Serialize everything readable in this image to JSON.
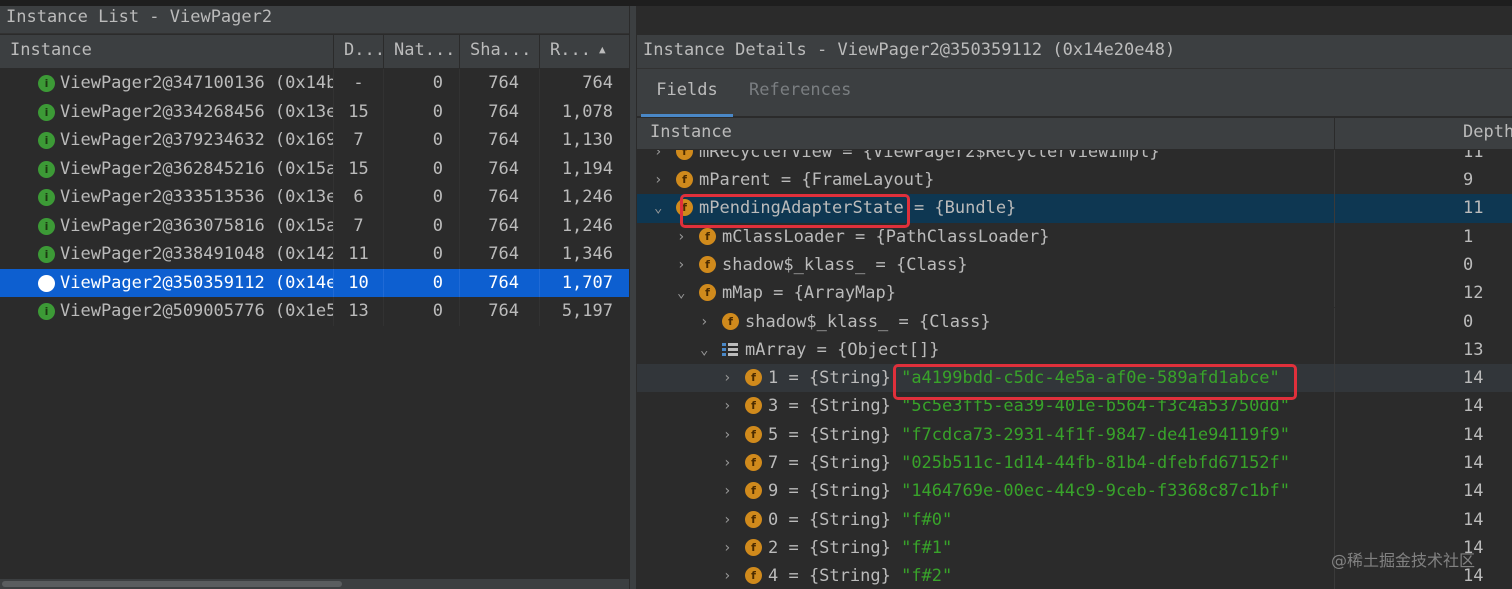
{
  "left_panel": {
    "title": "Instance List - ViewPager2",
    "columns": [
      "Instance",
      "D...",
      "Nat...",
      "Sha...",
      "R..."
    ],
    "rows": [
      {
        "name": "ViewPager2@347100136 (0x14b",
        "d": "-",
        "nat": "0",
        "sha": "764",
        "r": "764"
      },
      {
        "name": "ViewPager2@334268456 (0x13e",
        "d": "15",
        "nat": "0",
        "sha": "764",
        "r": "1,078"
      },
      {
        "name": "ViewPager2@379234632 (0x169",
        "d": "7",
        "nat": "0",
        "sha": "764",
        "r": "1,130"
      },
      {
        "name": "ViewPager2@362845216 (0x15a",
        "d": "15",
        "nat": "0",
        "sha": "764",
        "r": "1,194"
      },
      {
        "name": "ViewPager2@333513536 (0x13e",
        "d": "6",
        "nat": "0",
        "sha": "764",
        "r": "1,246"
      },
      {
        "name": "ViewPager2@363075816 (0x15a",
        "d": "7",
        "nat": "0",
        "sha": "764",
        "r": "1,246"
      },
      {
        "name": "ViewPager2@338491048 (0x142",
        "d": "11",
        "nat": "0",
        "sha": "764",
        "r": "1,346"
      },
      {
        "name": "ViewPager2@350359112 (0x14e",
        "d": "10",
        "nat": "0",
        "sha": "764",
        "r": "1,707"
      },
      {
        "name": "ViewPager2@509005776 (0x1e5",
        "d": "13",
        "nat": "0",
        "sha": "764",
        "r": "5,197"
      }
    ],
    "selected_index": 7,
    "instance_icon": "i"
  },
  "right_panel": {
    "title": "Instance Details - ViewPager2@350359112 (0x14e20e48)",
    "tabs": {
      "fields": "Fields",
      "references": "References"
    },
    "columns": {
      "instance": "Instance",
      "depth": "Depth"
    },
    "field_icon": "f",
    "rows": [
      {
        "text": "mRecyclerView = {ViewPager2$RecyclerViewImpl}",
        "depth": "11"
      },
      {
        "text": "mParent = {FrameLayout}",
        "depth": "9"
      },
      {
        "name": "mPendingAdapterState",
        "rest": " = {Bundle}",
        "depth": "11"
      },
      {
        "text": "mClassLoader = {PathClassLoader}",
        "depth": "1"
      },
      {
        "text": "shadow$_klass_ = {Class}",
        "depth": "0"
      },
      {
        "text": "mMap = {ArrayMap}",
        "depth": "12"
      },
      {
        "text": "shadow$_klass_ = {Class}",
        "depth": "0"
      },
      {
        "text": "mArray = {Object[]}",
        "depth": "13"
      },
      {
        "text": "1 = {String}",
        "value": "\"a4199bdd-c5dc-4e5a-af0e-589afd1abce\"",
        "depth": "14"
      },
      {
        "text": "3 = {String}",
        "value": "\"5c5e3ff5-ea39-401e-b564-f3c4a53750dd\"",
        "depth": "14"
      },
      {
        "text": "5 = {String}",
        "value": "\"f7cdca73-2931-4f1f-9847-de41e94119f9\"",
        "depth": "14"
      },
      {
        "text": "7 = {String}",
        "value": "\"025b511c-1d14-44fb-81b4-dfebfd67152f\"",
        "depth": "14"
      },
      {
        "text": "9 = {String}",
        "value": "\"1464769e-00ec-44c9-9ceb-f3368c87c1bf\"",
        "depth": "14"
      },
      {
        "text": "0 = {String}",
        "value": "\"f#0\"",
        "depth": "14"
      },
      {
        "text": "2 = {String}",
        "value": "\"f#1\"",
        "depth": "14"
      },
      {
        "text": "4 = {String}",
        "value": "\"f#2\"",
        "depth": "14"
      }
    ]
  },
  "watermark": "@稀土掘金技术社区",
  "colors": {
    "selection": "#0d5fd0",
    "highlight_row": "#0e3752",
    "annotation": "#e0303b",
    "string": "#38a32a",
    "field_icon": "#d08a1c",
    "instance_icon": "#3c9a36"
  }
}
